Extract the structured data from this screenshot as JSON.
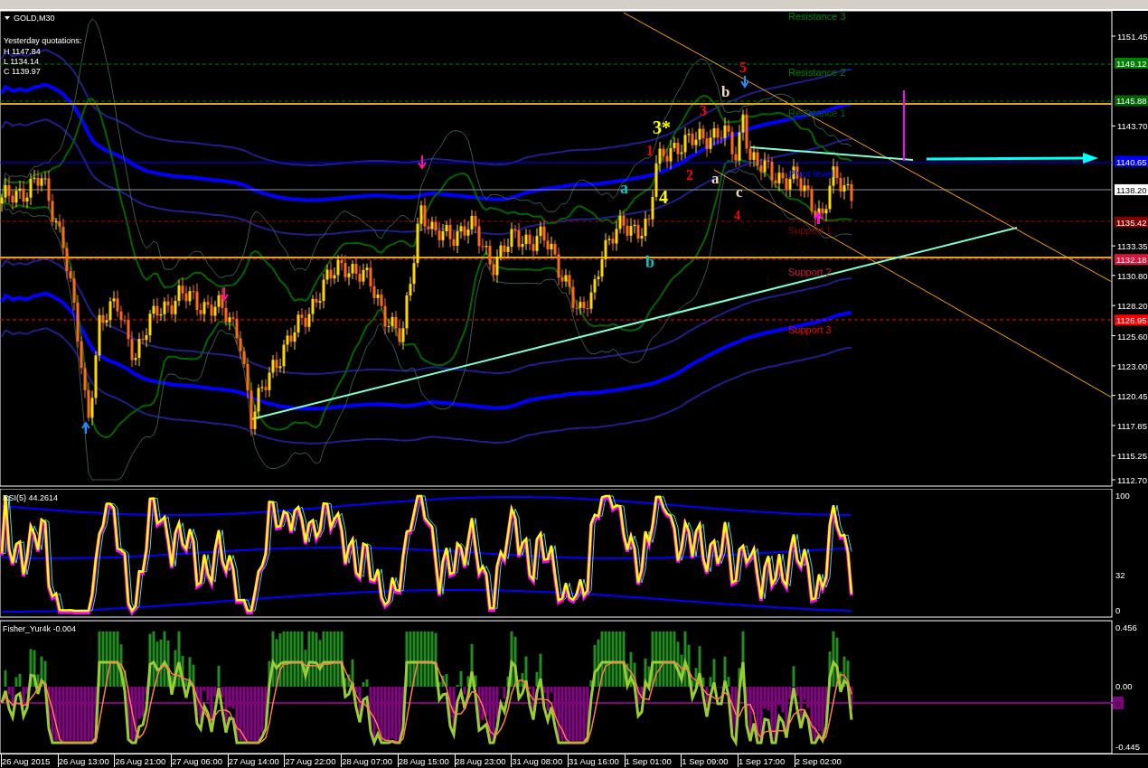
{
  "chart": {
    "symbol": "GOLD,M30",
    "quotations": {
      "title": "Yesterday quotations:",
      "lines": [
        "H 1147.84",
        "L 1134.14",
        "C 1139.97"
      ]
    },
    "price_axis": [
      "1151.45",
      "1143.70",
      "1133.35",
      "1130.80",
      "1128.20",
      "1125.60",
      "1123.00",
      "1120.45",
      "1117.85",
      "1115.25",
      "1112.70"
    ],
    "price_tags": [
      {
        "text": "1149.12",
        "color": "#008000"
      },
      {
        "text": "1145.88",
        "color": "#006400"
      },
      {
        "text": "1140.65",
        "color": "#0000ff"
      },
      {
        "text": "1138.20",
        "color": "#ffffff"
      },
      {
        "text": "1135.42",
        "color": "#800000"
      },
      {
        "text": "1132.18",
        "color": "#dc143c"
      },
      {
        "text": "1126.95",
        "color": "#ff0000"
      }
    ],
    "levels": [
      {
        "label": "Resistance 3",
        "color": "#008000"
      },
      {
        "label": "Resistance 2",
        "color": "#008000"
      },
      {
        "label": "Resistance 1",
        "color": "#006400"
      },
      {
        "label": "Pivot level",
        "color": "#0000ff"
      },
      {
        "label": "Support 1",
        "color": "#800000"
      },
      {
        "label": "Support 2",
        "color": "#dc143c"
      },
      {
        "label": "Support 3",
        "color": "#ff0000"
      }
    ],
    "wave_labels": [
      {
        "text": "3*",
        "color": "#ffff00"
      },
      {
        "text": "3",
        "color": "#ff0000"
      },
      {
        "text": "1",
        "color": "#ff0000"
      },
      {
        "text": "2",
        "color": "#ff0000"
      },
      {
        "text": "a",
        "color": "#f5deb3"
      },
      {
        "text": "b",
        "color": "#f5deb3"
      },
      {
        "text": "c",
        "color": "#f5deb3"
      },
      {
        "text": "4",
        "color": "#ff0000"
      },
      {
        "text": "5",
        "color": "#ff0000"
      },
      {
        "text": "a",
        "color": "#00c8c8"
      },
      {
        "text": "b",
        "color": "#00c8c8"
      },
      {
        "text": "4",
        "color": "#ffff00"
      }
    ]
  },
  "rsi": {
    "label": "RSI(5) 44.2614",
    "axis": [
      "100",
      "32",
      "0"
    ]
  },
  "fisher": {
    "label": "Fisher_Yur4k -0.004",
    "axis": [
      "0.456",
      "0.00",
      "-0.445"
    ],
    "zero_tag": "0"
  },
  "time_axis": [
    "26 Aug 2015",
    "26 Aug 13:00",
    "26 Aug 21:00",
    "27 Aug 06:00",
    "27 Aug 14:00",
    "27 Aug 22:00",
    "28 Aug 07:00",
    "28 Aug 15:00",
    "28 Aug 23:00",
    "31 Aug 08:00",
    "31 Aug 16:00",
    "1 Sep 01:00",
    "1 Sep 09:00",
    "1 Sep 17:00",
    "2 Sep 02:00"
  ]
}
